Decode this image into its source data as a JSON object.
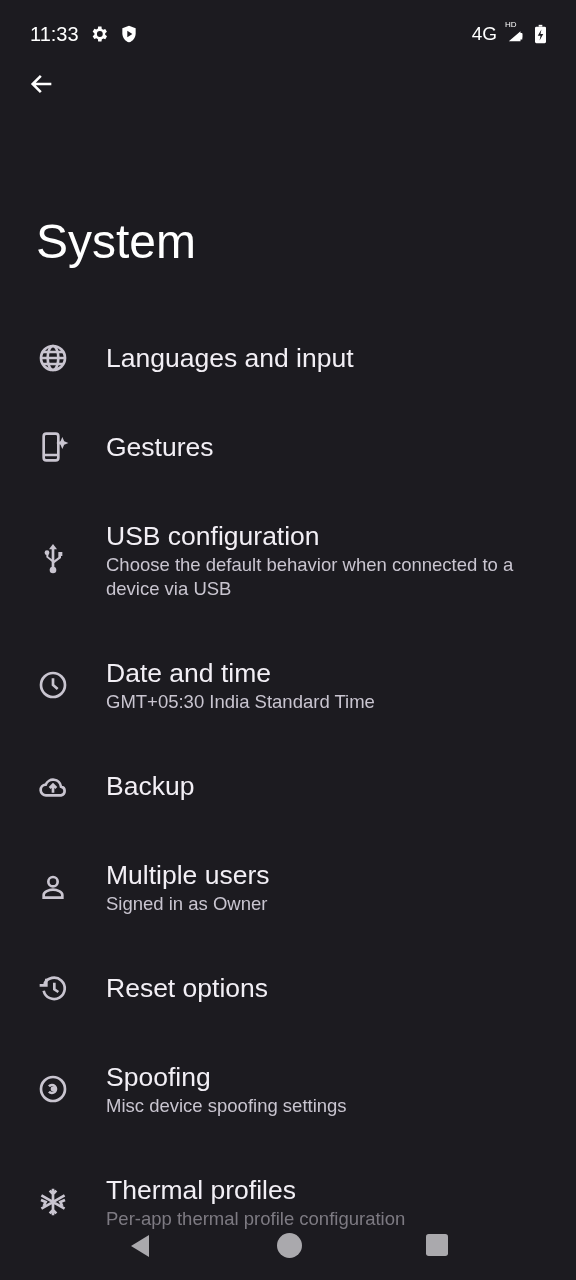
{
  "status_bar": {
    "time": "11:33",
    "network": "4G",
    "signal_badge": "HD"
  },
  "title": "System",
  "items": [
    {
      "title": "Languages and input"
    },
    {
      "title": "Gestures"
    },
    {
      "title": "USB configuration",
      "subtitle": "Choose the default behavior when connected to a device via USB"
    },
    {
      "title": "Date and time",
      "subtitle": "GMT+05:30 India Standard Time"
    },
    {
      "title": "Backup"
    },
    {
      "title": "Multiple users",
      "subtitle": "Signed in as Owner"
    },
    {
      "title": "Reset options"
    },
    {
      "title": "Spoofing",
      "subtitle": "Misc device spoofing settings"
    },
    {
      "title": "Thermal profiles",
      "subtitle": "Per-app thermal profile configuration"
    }
  ]
}
